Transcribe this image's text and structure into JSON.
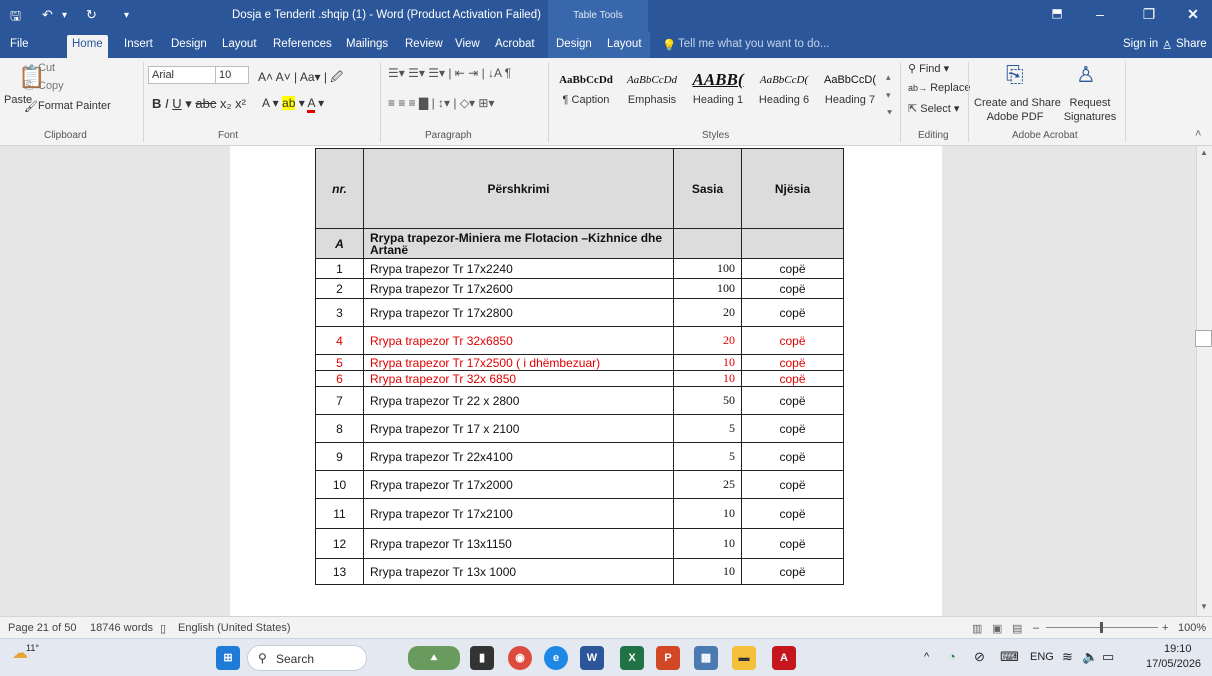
{
  "title": {
    "text": "Dosja e Tenderit .shqip (1) - Word (Product Activation Failed)",
    "context": "Table Tools",
    "save_icon": "save-icon",
    "undo_icon": "undo-icon",
    "redo_icon": "redo-icon"
  },
  "tabs": [
    "File",
    "Home",
    "Insert",
    "Design",
    "Layout",
    "References",
    "Mailings",
    "Review",
    "View",
    "Acrobat",
    "Design",
    "Layout"
  ],
  "tell_me": "Tell me what you want to do...",
  "sign_in": "Sign in",
  "share": "Share",
  "clipboard": {
    "paste": "Paste",
    "cut": "Cut",
    "copy": "Copy",
    "format_painter": "Format Painter",
    "group": "Clipboard"
  },
  "font": {
    "name": "Arial",
    "size": "10",
    "group": "Font"
  },
  "paragraph": {
    "group": "Paragraph"
  },
  "styles": {
    "items": [
      {
        "preview": "AaBbCcDd",
        "name": "¶ Caption"
      },
      {
        "preview": "AaBbCcDd",
        "name": "Emphasis"
      },
      {
        "preview": "AABB(",
        "name": "Heading 1"
      },
      {
        "preview": "AaBbCcD(",
        "name": "Heading 6"
      },
      {
        "preview": "AaBbCcD(",
        "name": "Heading 7"
      }
    ],
    "group": "Styles"
  },
  "editing": {
    "find": "Find",
    "replace": "Replace",
    "select": "Select",
    "group": "Editing"
  },
  "acrobat": {
    "create": "Create and Share",
    "create2": "Adobe PDF",
    "request": "Request",
    "request2": "Signatures",
    "group": "Adobe Acrobat"
  },
  "table": {
    "headers": [
      "nr.",
      "Përshkrimi",
      "Sasia",
      "Njësia"
    ],
    "section": {
      "label": "A",
      "title": "Rrypa trapezor-Miniera me Flotacion –Kizhnice dhe Artanë"
    },
    "rows": [
      {
        "nr": "1",
        "desc": "Rrypa trapezor Tr 17x2240",
        "qty": "100",
        "unit": "copë",
        "red": false
      },
      {
        "nr": "2",
        "desc": "Rrypa trapezor Tr 17x2600",
        "qty": "100",
        "unit": "copë",
        "red": false
      },
      {
        "nr": "3",
        "desc": "Rrypa trapezor Tr 17x2800",
        "qty": "20",
        "unit": "copë",
        "red": false
      },
      {
        "nr": "4",
        "desc": "Rrypa trapezor Tr 32x6850",
        "qty": "20",
        "unit": "copë",
        "red": true
      },
      {
        "nr": "5",
        "desc": "Rrypa trapezor Tr 17x2500 ( i dhëmbezuar)",
        "qty": "10",
        "unit": "copë",
        "red": true
      },
      {
        "nr": "6",
        "desc": "Rrypa trapezor Tr 32x 6850",
        "qty": "10",
        "unit": "copë",
        "red": true
      },
      {
        "nr": "7",
        "desc": "Rrypa trapezor Tr 22 x 2800",
        "qty": "50",
        "unit": "copë",
        "red": false
      },
      {
        "nr": "8",
        "desc": "Rrypa trapezor Tr 17 x 2100",
        "qty": "5",
        "unit": "copë",
        "red": false
      },
      {
        "nr": "9",
        "desc": "Rrypa trapezor Tr 22x4100",
        "qty": "5",
        "unit": "copë",
        "red": false
      },
      {
        "nr": "10",
        "desc": "Rrypa trapezor Tr 17x2000",
        "qty": "25",
        "unit": "copë",
        "red": false
      },
      {
        "nr": "11",
        "desc": "Rrypa trapezor Tr 17x2100",
        "qty": "10",
        "unit": "copë",
        "red": false
      },
      {
        "nr": "12",
        "desc": "Rrypa trapezor Tr 13x1150",
        "qty": "10",
        "unit": "copë",
        "red": false
      },
      {
        "nr": "13",
        "desc": "Rrypa trapezor Tr 13x 1000",
        "qty": "10",
        "unit": "copë",
        "red": false
      }
    ]
  },
  "status": {
    "page": "Page 21 of 50",
    "words": "18746 words",
    "language": "English (United States)",
    "zoom": "100%"
  },
  "taskbar": {
    "weather": "11°",
    "search": "Search",
    "lang": "ENG",
    "time": "19:10",
    "date": "17/05/2026"
  },
  "colors": {
    "accent": "#2b579a",
    "red_text": "#e00000"
  }
}
